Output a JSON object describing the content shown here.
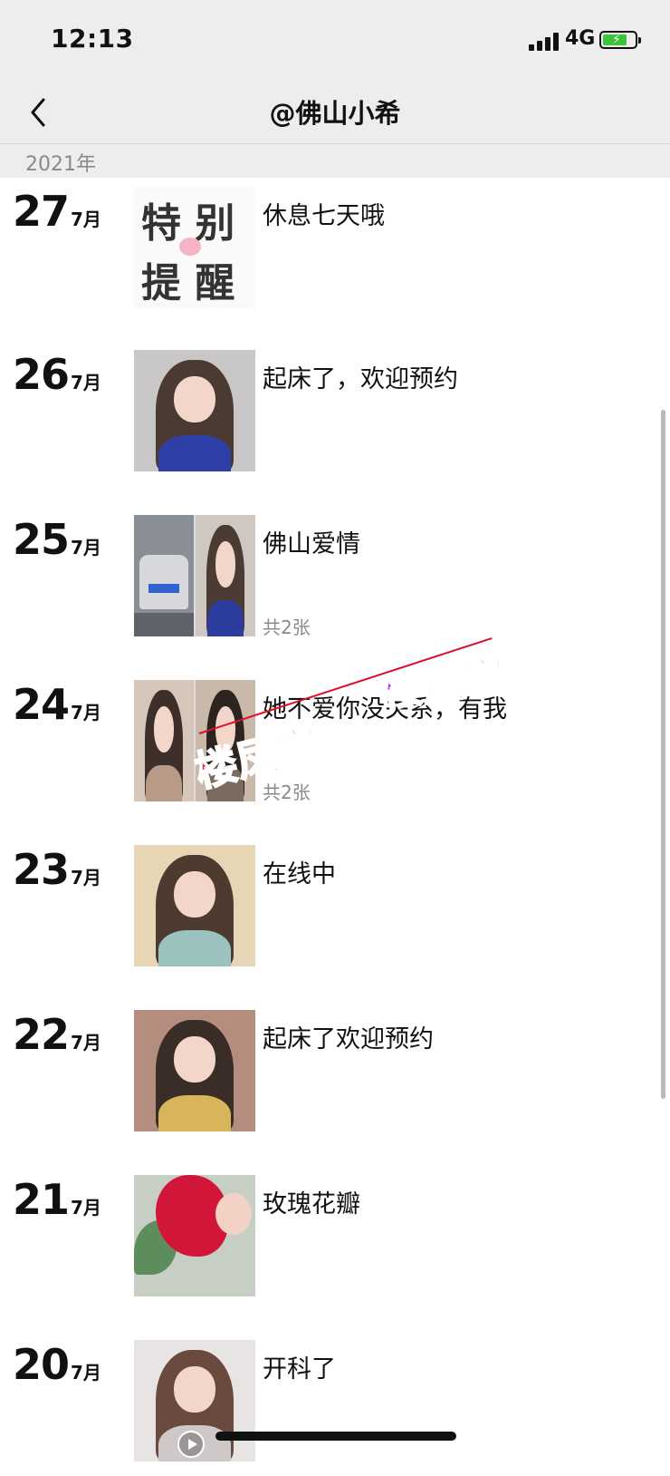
{
  "status_bar": {
    "time": "12:13",
    "network": "4G"
  },
  "nav": {
    "title": "@佛山小希"
  },
  "year": "2021年",
  "entries": [
    {
      "day": "27",
      "month": "7月",
      "caption": "休息七天哦",
      "image": "notice-graphic",
      "notice_lines": [
        "特 别",
        "提 醒"
      ]
    },
    {
      "day": "26",
      "month": "7月",
      "caption": "起床了，欢迎预约",
      "image": "portrait"
    },
    {
      "day": "25",
      "month": "7月",
      "caption": "佛山爱情",
      "image": "car-and-portrait",
      "count": "共2张"
    },
    {
      "day": "24",
      "month": "7月",
      "caption": "她不爱你没关系，有我",
      "image": "two-portraits",
      "count": "共2张"
    },
    {
      "day": "23",
      "month": "7月",
      "caption": "在线中",
      "image": "portrait"
    },
    {
      "day": "22",
      "month": "7月",
      "caption": "起床了欢迎预约",
      "image": "portrait"
    },
    {
      "day": "21",
      "month": "7月",
      "caption": "玫瑰花瓣",
      "image": "rose-portrait"
    },
    {
      "day": "20",
      "month": "7月",
      "caption": "开科了",
      "image": "video-portrait"
    }
  ],
  "watermark": {
    "text_top": "楼凤宫",
    "text_bottom": "楼凤宫"
  },
  "colors": {
    "nav_bg": "#ededed",
    "battery": "#3ac43a",
    "watermark_purple": "#b428e0",
    "watermark_red": "#ee1a3a"
  },
  "icons": [
    "signal-icon",
    "battery-icon",
    "back-chevron-icon",
    "play-icon"
  ]
}
